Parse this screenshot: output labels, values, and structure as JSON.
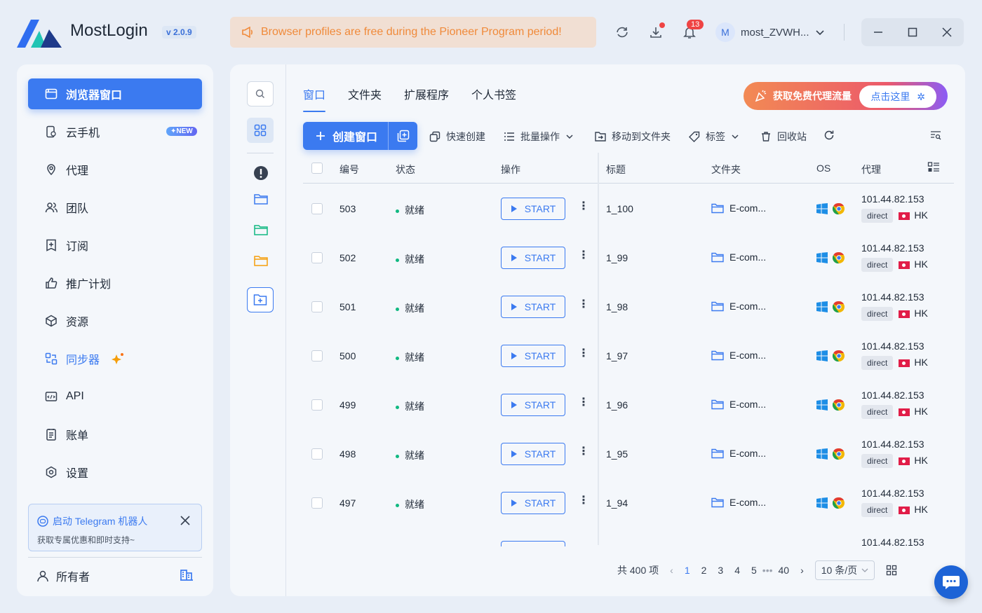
{
  "app": {
    "name": "MostLogin",
    "version": "v 2.0.9"
  },
  "banner": {
    "text": "Browser profiles are free during the Pioneer Program period!"
  },
  "notifications": {
    "count": "13"
  },
  "user": {
    "avatar_letter": "M",
    "name": "most_ZVWH..."
  },
  "sidebar": {
    "items": [
      {
        "label": "浏览器窗口",
        "icon": "browser-window-icon"
      },
      {
        "label": "云手机",
        "icon": "cloud-phone-icon",
        "badge": "✦NEW"
      },
      {
        "label": "代理",
        "icon": "location-pin-icon"
      },
      {
        "label": "团队",
        "icon": "team-icon"
      },
      {
        "label": "订阅",
        "icon": "subscribe-icon"
      },
      {
        "label": "推广计划",
        "icon": "thumbs-up-icon"
      },
      {
        "label": "资源",
        "icon": "cube-icon"
      },
      {
        "label": "同步器",
        "icon": "sync-icon"
      },
      {
        "label": "API",
        "icon": "api-icon"
      },
      {
        "label": "账单",
        "icon": "bill-icon"
      },
      {
        "label": "设置",
        "icon": "settings-icon"
      }
    ],
    "telegram": {
      "title": "启动 Telegram 机器人",
      "subtitle": "获取专属优惠和即时支持~"
    },
    "owner": {
      "label": "所有者"
    }
  },
  "tabs": [
    "窗口",
    "文件夹",
    "扩展程序",
    "个人书签"
  ],
  "promo": {
    "text": "获取免费代理流量",
    "button": "点击这里"
  },
  "toolbar": {
    "create": "创建窗口",
    "quick_create": "快速创建",
    "batch": "批量操作",
    "move_to_folder": "移动到文件夹",
    "tags": "标签",
    "recycle": "回收站"
  },
  "table": {
    "columns": [
      "编号",
      "状态",
      "操作",
      "标题",
      "文件夹",
      "OS",
      "代理"
    ],
    "rows": [
      {
        "id": "503",
        "status": "就绪",
        "action": "START",
        "title": "1_100",
        "folder": "E-com...",
        "proxy_ip": "101.44.82.153",
        "proxy_type": "direct",
        "region": "HK"
      },
      {
        "id": "502",
        "status": "就绪",
        "action": "START",
        "title": "1_99",
        "folder": "E-com...",
        "proxy_ip": "101.44.82.153",
        "proxy_type": "direct",
        "region": "HK"
      },
      {
        "id": "501",
        "status": "就绪",
        "action": "START",
        "title": "1_98",
        "folder": "E-com...",
        "proxy_ip": "101.44.82.153",
        "proxy_type": "direct",
        "region": "HK"
      },
      {
        "id": "500",
        "status": "就绪",
        "action": "START",
        "title": "1_97",
        "folder": "E-com...",
        "proxy_ip": "101.44.82.153",
        "proxy_type": "direct",
        "region": "HK"
      },
      {
        "id": "499",
        "status": "就绪",
        "action": "START",
        "title": "1_96",
        "folder": "E-com...",
        "proxy_ip": "101.44.82.153",
        "proxy_type": "direct",
        "region": "HK"
      },
      {
        "id": "498",
        "status": "就绪",
        "action": "START",
        "title": "1_95",
        "folder": "E-com...",
        "proxy_ip": "101.44.82.153",
        "proxy_type": "direct",
        "region": "HK"
      },
      {
        "id": "497",
        "status": "就绪",
        "action": "START",
        "title": "1_94",
        "folder": "E-com...",
        "proxy_ip": "101.44.82.153",
        "proxy_type": "direct",
        "region": "HK"
      }
    ],
    "partial_row_proxy": "101.44.82.153"
  },
  "pagination": {
    "total": "共 400 项",
    "pages": [
      "1",
      "2",
      "3",
      "4",
      "5"
    ],
    "ellipsis": "•••",
    "last": "40",
    "page_size": "10 条/页"
  },
  "colors": {
    "accent": "#3b7af0",
    "banner_text": "#f08a3a",
    "status_ready": "#10b981",
    "badge": "#ef4444"
  }
}
